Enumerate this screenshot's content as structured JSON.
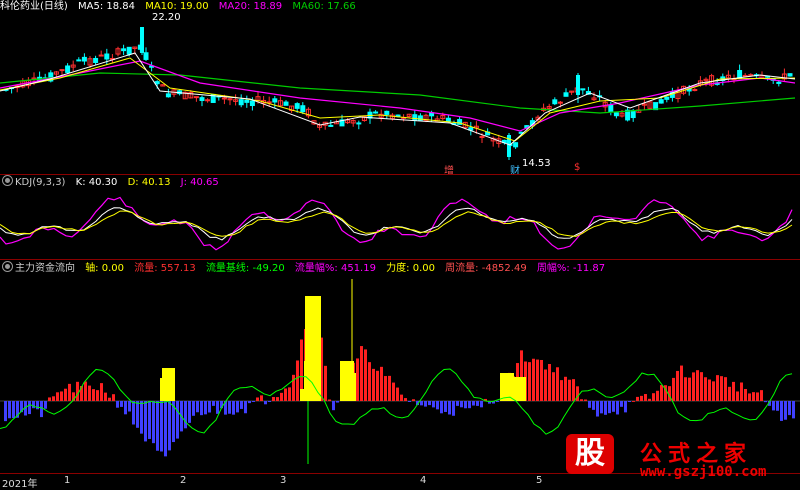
{
  "main_pane": {
    "title": "科伦药业(日线)",
    "ma": [
      {
        "label": "MA5: 18.84",
        "color": "#ffffff"
      },
      {
        "label": "MA10: 19.00",
        "color": "#ffff00"
      },
      {
        "label": "MA20: 18.89",
        "color": "#ff00ff"
      },
      {
        "label": "MA60: 17.66",
        "color": "#00cc00"
      }
    ],
    "high_label": "22.20",
    "low_label": "14.53",
    "tags": [
      {
        "text": "增",
        "color": "#ff5050"
      },
      {
        "text": "财",
        "color": "#40c0ff"
      },
      {
        "text": "$",
        "color": "#ff3030"
      }
    ]
  },
  "kdj_pane": {
    "title": "KDJ(9,3,3)",
    "values": [
      {
        "label": "K: 40.30",
        "color": "#ffffff"
      },
      {
        "label": "D: 40.13",
        "color": "#ffff00"
      },
      {
        "label": "J: 40.65",
        "color": "#ff00ff"
      }
    ]
  },
  "flow_pane": {
    "title": "主力资金流向",
    "values": [
      {
        "label": "轴: 0.00",
        "color": "#ffffff"
      },
      {
        "label": "流量: 557.13",
        "color": "#ff3030"
      },
      {
        "label": "流量基线: -49.20",
        "color": "#00ff00"
      },
      {
        "label": "流量幅%: 451.19",
        "color": "#ff00ff"
      },
      {
        "label": "力度: 0.00",
        "color": "#ffff00"
      },
      {
        "label": "周流量: -4852.49",
        "color": "#ff5050"
      },
      {
        "label": "周幅%: -11.87",
        "color": "#ff00ff"
      }
    ]
  },
  "x_axis": [
    "2021年",
    "1",
    "2",
    "3",
    "4",
    "5"
  ],
  "watermark": {
    "icon_char": "股",
    "text": "公式之家",
    "url": "www.gszj100.com"
  },
  "colors": {
    "up": "#ff3030",
    "down": "#00ffff",
    "separator": "#8a0000"
  }
}
